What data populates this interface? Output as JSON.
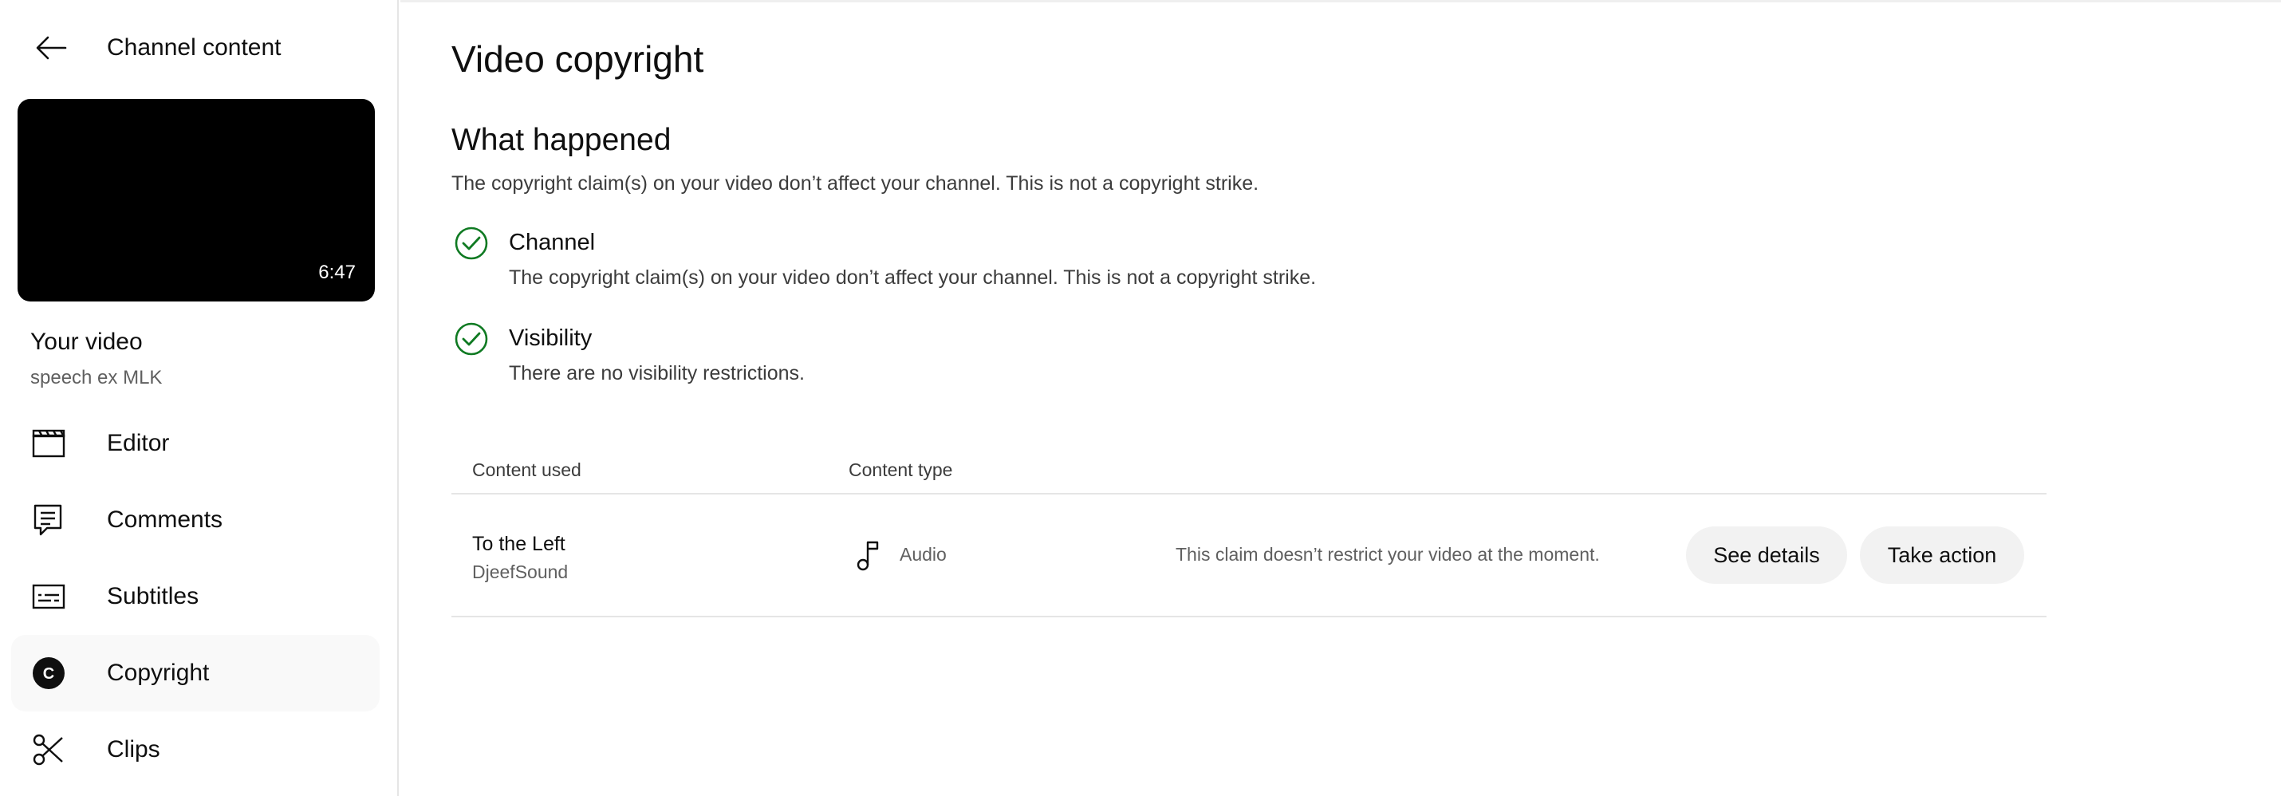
{
  "sidebar": {
    "title": "Channel content",
    "video": {
      "duration": "6:47",
      "title": "Your video",
      "subtitle": "speech ex MLK"
    },
    "items": [
      {
        "label": "Editor",
        "icon": "clapperboard-icon"
      },
      {
        "label": "Comments",
        "icon": "comment-icon"
      },
      {
        "label": "Subtitles",
        "icon": "subtitles-icon"
      },
      {
        "label": "Copyright",
        "icon": "copyright-icon",
        "active": true
      },
      {
        "label": "Clips",
        "icon": "scissors-icon"
      }
    ]
  },
  "main": {
    "page_title": "Video copyright",
    "section_title": "What happened",
    "section_desc": "The copyright claim(s) on your video don’t affect your channel. This is not a copyright strike.",
    "statuses": [
      {
        "label": "Channel",
        "desc": "The copyright claim(s) on your video don’t affect your channel. This is not a copyright strike."
      },
      {
        "label": "Visibility",
        "desc": "There are no visibility restrictions."
      }
    ],
    "table": {
      "headers": [
        "Content used",
        "Content type"
      ],
      "rows": [
        {
          "title": "To the Left",
          "artist": "DjeefSound",
          "type": "Audio",
          "message": "This claim doesn’t restrict your video at the moment.",
          "see_details": "See details",
          "take_action": "Take action"
        }
      ]
    }
  },
  "colors": {
    "check_green": "#0f7a22",
    "active_bg": "#f9f9f9",
    "pill_bg": "#f2f2f2"
  }
}
